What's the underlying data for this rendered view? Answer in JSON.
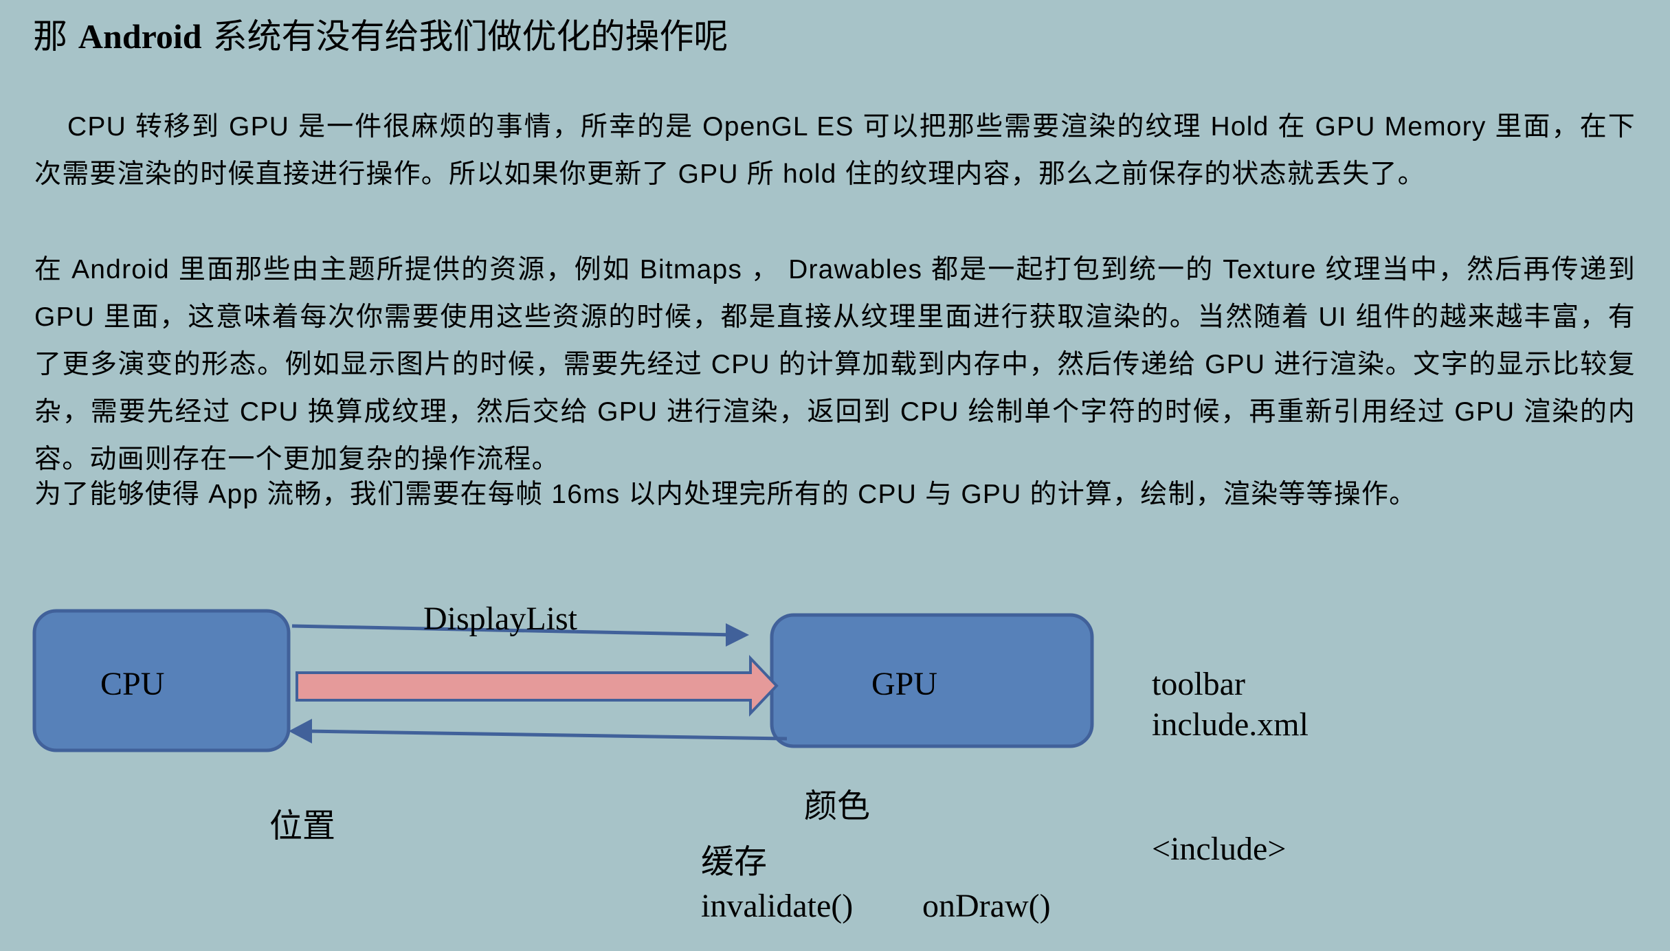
{
  "colors": {
    "background": "#a7c3c8",
    "box_fill": "#5781b9",
    "box_stroke": "#41619a",
    "arrow_line": "#41619a",
    "big_arrow_fill": "#e59a9a",
    "big_arrow_stroke": "#41619a"
  },
  "title": {
    "prefix": "那 ",
    "bold": "Android",
    "suffix": " 系统有没有给我们做优化的操作呢"
  },
  "paragraphs": [
    "CPU 转移到 GPU 是一件很麻烦的事情，所幸的是 OpenGL ES 可以把那些需要渲染的纹理 Hold 在 GPU Memory 里面，在下次需要渲染的时候直接进行操作。所以如果你更新了 GPU 所 hold 住的纹理内容，那么之前保存的状态就丢失了。",
    "在 Android 里面那些由主题所提供的资源，例如 Bitmaps ， Drawables 都是一起打包到统一的 Texture 纹理当中，然后再传递到 GPU 里面，这意味着每次你需要使用这些资源的时候，都是直接从纹理里面进行获取渲染的。当然随着 UI 组件的越来越丰富，有了更多演变的形态。例如显示图片的时候，需要先经过 CPU 的计算加载到内存中，然后传递给 GPU 进行渲染。文字的显示比较复杂，需要先经过 CPU 换算成纹理，然后交给 GPU 进行渲染，返回到 CPU 绘制单个字符的时候，再重新引用经过 GPU 渲染的内容。动画则存在一个更加复杂的操作流程。",
    "为了能够使得 App 流畅，我们需要在每帧 16ms 以内处理完所有的 CPU 与 GPU 的计算，绘制，渲染等等操作。"
  ],
  "diagram": {
    "cpu_label": "CPU",
    "gpu_label": "GPU",
    "displaylist_label": "DisplayList",
    "position_label": "位置",
    "color_label": "颜色",
    "cache_label": "缓存",
    "invalidate_label": "invalidate()",
    "ondraw_label": "onDraw()",
    "toolbar_label": "toolbar",
    "include_xml_label": "include.xml",
    "include_tag_label": "<include>"
  }
}
